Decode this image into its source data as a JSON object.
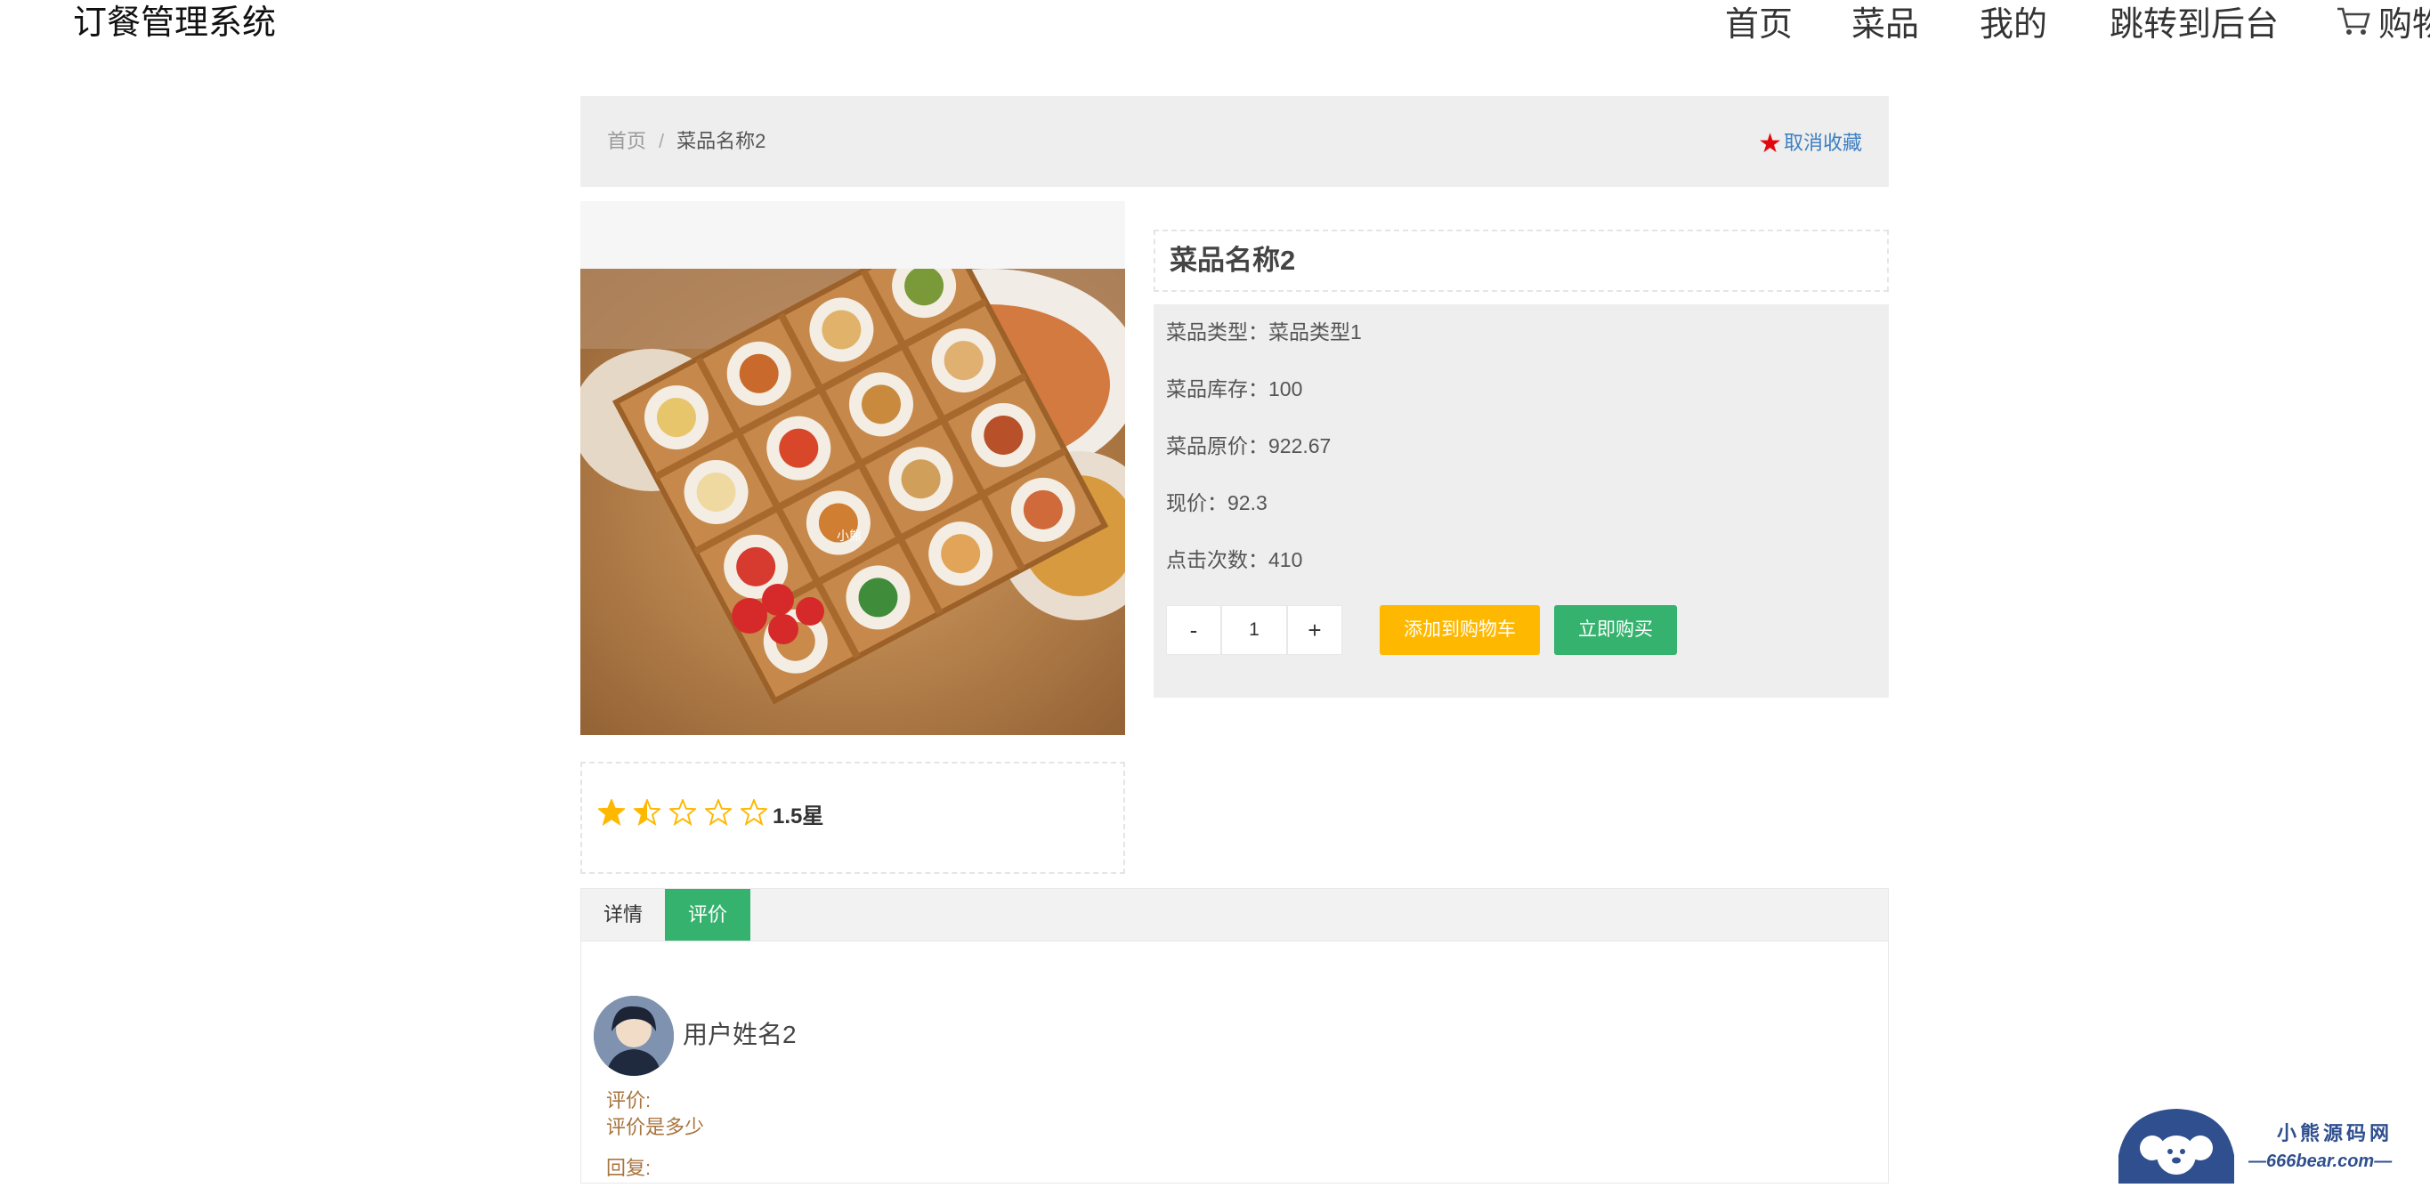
{
  "app": {
    "title": "订餐管理系统"
  },
  "nav": {
    "items": [
      "首页",
      "菜品",
      "我的",
      "跳转到后台"
    ],
    "cart_label": "购物"
  },
  "breadcrumb": {
    "home": "首页",
    "separator": "/",
    "current": "菜品名称2"
  },
  "favorite": {
    "label": "取消收藏",
    "icon": "star-icon",
    "color": "#e4060f"
  },
  "dish": {
    "name": "菜品名称2",
    "type_label": "菜品类型：",
    "type_value": "菜品类型1",
    "stock_label": "菜品库存：",
    "stock_value": "100",
    "orig_price_label": "菜品原价：",
    "orig_price_value": "922.67",
    "price_label": "现价：",
    "price_value": "92.3",
    "clicks_label": "点击次数：",
    "clicks_value": "410",
    "image_caption": "小熊"
  },
  "rating": {
    "value": 1.5,
    "max": 5,
    "text": "1.5星",
    "star_color": "#ffb800"
  },
  "quantity": {
    "minus": "-",
    "value": "1",
    "plus": "+"
  },
  "actions": {
    "add_to_cart": "添加到购物车",
    "buy_now": "立即购买",
    "cart_color": "#ffb800",
    "buy_color": "#35b36e"
  },
  "tabs": {
    "items": [
      "详情",
      "评价"
    ],
    "active": "评价"
  },
  "comment": {
    "user": "用户姓名2",
    "review_label": "评价:",
    "review_text": "评价是多少",
    "reply_label": "回复:"
  },
  "watermark": {
    "title": "小熊源码网",
    "url": "666bear.com"
  }
}
